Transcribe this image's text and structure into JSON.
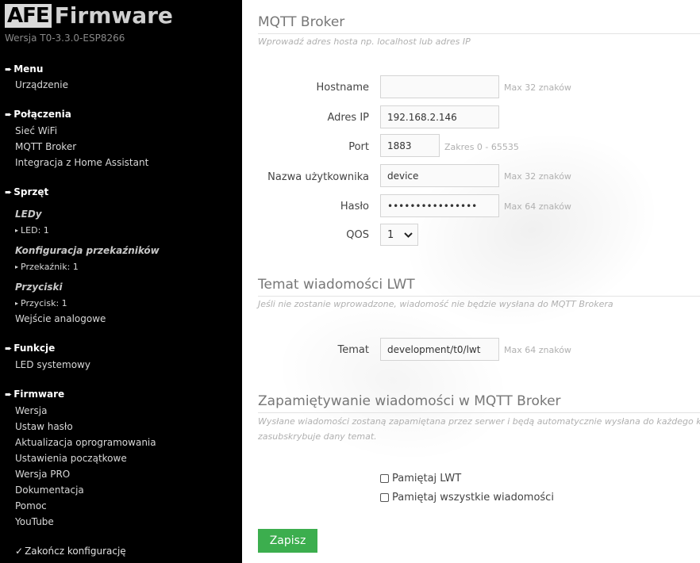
{
  "sidebar": {
    "logo_afe": "AFE",
    "logo_firmware": "Firmware",
    "version": "Wersja T0-3.3.0-ESP8266",
    "arrow_glyph": "➨",
    "dot_glyph": "▸",
    "sections": {
      "menu": {
        "title": "Menu",
        "items": [
          "Urządzenie"
        ]
      },
      "connections": {
        "title": "Połączenia",
        "items": [
          "Sieć WiFi",
          "MQTT Broker",
          "Integracja z Home Assistant"
        ]
      },
      "hardware": {
        "title": "Sprzęt",
        "groups": [
          {
            "label": "LEDy",
            "item": "LED: 1"
          },
          {
            "label": "Konfiguracja przekaźników",
            "item": "Przekaźnik: 1"
          },
          {
            "label": "Przyciski",
            "item": "Przycisk: 1"
          }
        ],
        "analog": "Wejście analogowe"
      },
      "functions": {
        "title": "Funkcje",
        "items": [
          "LED systemowy"
        ]
      },
      "firmware": {
        "title": "Firmware",
        "items": [
          "Wersja",
          "Ustaw hasło",
          "Aktualizacja oprogramowania",
          "Ustawienia początkowe",
          "Wersja PRO",
          "Dokumentacja",
          "Pomoc",
          "YouTube"
        ]
      }
    },
    "finish": "Zakończ konfigurację",
    "check_glyph": "✓"
  },
  "main": {
    "broker": {
      "title": "MQTT Broker",
      "description": "Wprowadź adres hosta np. localhost lub adres IP",
      "hostname": {
        "label": "Hostname",
        "value": "",
        "hint": "Max 32 znaków"
      },
      "ip": {
        "label": "Adres IP",
        "value": "192.168.2.146"
      },
      "port": {
        "label": "Port",
        "value": "1883",
        "hint": "Zakres 0 - 65535"
      },
      "user": {
        "label": "Nazwa użytkownika",
        "value": "device",
        "hint": "Max 32 znaków"
      },
      "password": {
        "label": "Hasło",
        "value": "••••••••••••••••",
        "hint": "Max 64 znaków"
      },
      "qos": {
        "label": "QOS",
        "value": "1"
      }
    },
    "lwt": {
      "title": "Temat wiadomości LWT",
      "description": "Jeśli nie zostanie wprowadzone, wiadomość nie będzie wysłana do MQTT Brokera",
      "topic": {
        "label": "Temat",
        "value": "development/t0/lwt",
        "hint": "Max 64 znaków"
      }
    },
    "retain": {
      "title": "Zapamiętywanie wiadomości w MQTT Broker",
      "description_line1": "Wysłane wiadomości zostaną zapamiętana przez serwer i będą automatycznie wysłana do każdego kto",
      "description_line2": "zasubskrybuje dany temat.",
      "lwt_checkbox": {
        "label": "Pamiętaj LWT",
        "checked": false
      },
      "all_checkbox": {
        "label": "Pamiętaj wszystkie wiadomości",
        "checked": false
      }
    },
    "save_button": "Zapisz"
  },
  "colors": {
    "sidebar_bg": "#000000",
    "save_button": "#3cae4e",
    "heading": "#777777"
  }
}
